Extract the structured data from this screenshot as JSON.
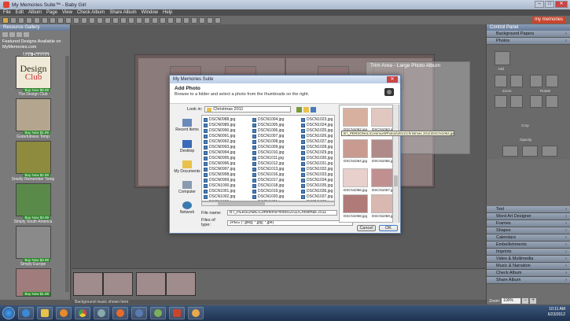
{
  "window": {
    "title": "My Memories Suite™ - Baby Girl"
  },
  "menu": [
    "File",
    "Edit",
    "Album",
    "Page",
    "View",
    "Check Album",
    "Share Album",
    "Window",
    "Help"
  ],
  "brand": "my memories",
  "left_panel": {
    "title": "Resource Gallery",
    "featured": "Featured Designs Available on MyMemories.com",
    "more_button": "More Designs",
    "club_logo_line1": "Design",
    "club_logo_line2": "Club",
    "cards": [
      {
        "name": "The Design Club",
        "badge": "Buy Now $9.99"
      },
      {
        "name": "Gratefulness Temp",
        "badge": "Buy Now $1.99"
      },
      {
        "name": "Smelly Remember Temp",
        "badge": "Buy Now $2.99"
      },
      {
        "name": "Simply South America",
        "badge": "Buy Now $3.99"
      },
      {
        "name": "Simply Europe",
        "badge": "Buy Now $3.99"
      }
    ],
    "badge_last": "Buy Now $1.99"
  },
  "canvas": {
    "trim_title": "Trim Area - Large Photo Album"
  },
  "status": "Background music shown here",
  "control_panel": {
    "title": "Control Panel",
    "top_items": [
      "Background Papers",
      "Photos"
    ],
    "labels": {
      "add": "Add",
      "zoom": "Zoom",
      "rotate": "Rotate",
      "crop": "Crop",
      "opacity": "Opacity"
    },
    "bottom_items": [
      "Text",
      "Word Art Designer",
      "Frames",
      "Shapes",
      "Calendars",
      "Embellishments",
      "Imprints",
      "Video & Multimedia",
      "Music & Narration",
      "Check Album",
      "Share Album"
    ]
  },
  "zoom": {
    "label": "Zoom:",
    "value": "100%",
    "minus": "−",
    "plus": "+"
  },
  "dialog": {
    "title": "My Memories Suite",
    "close": "✕",
    "heading": "Add Photo",
    "subheading": "Browse to a folder and select a photo from the thumbnails on the right.",
    "look_in_label": "Look in:",
    "look_in_value": "Christmas 2011",
    "places": [
      "Recent Items",
      "Desktop",
      "My Documents",
      "Computer",
      "Network"
    ],
    "files_col1": [
      "DSCN0988.jpg",
      "DSCN0989.jpg",
      "DSCN0990.jpg",
      "DSCN0991.jpg",
      "DSCN0992.jpg",
      "DSCN0993.jpg",
      "DSCN0994.jpg",
      "DSCN0995.jpg",
      "DSCN0996.jpg",
      "DSCN0997.jpg",
      "DSCN0998.jpg",
      "DSCN0999.jpg",
      "DSCN1000.jpg",
      "DSCN1001.jpg",
      "DSCN1002.jpg",
      "DSCN1003.jpg"
    ],
    "files_col2": [
      "DSCN1004.jpg",
      "DSCN1005.jpg",
      "DSCN1006.jpg",
      "DSCN1007.jpg",
      "DSCN1008.jpg",
      "DSCN1009.jpg",
      "DSCN1010.jpg",
      "DSCN1011.jpg",
      "DSCN1012.jpg",
      "DSCN1013.jpg",
      "DSCN1016.jpg",
      "DSCN1017.jpg",
      "DSCN1018.jpg",
      "DSCN1019.jpg",
      "DSCN1020.jpg",
      "DSCN1021.jpg",
      "DSCN1022.jpg"
    ],
    "files_col3": [
      "DSCN1023.jpg",
      "DSCN1024.jpg",
      "DSCN1025.jpg",
      "DSCN1026.jpg",
      "DSCN1027.jpg",
      "DSCN1028.jpg",
      "DSCN1029.jpg",
      "DSCN1030.jpg",
      "DSCN1031.jpg",
      "DSCN1032.jpg",
      "DSCN1033.jpg",
      "DSCN1034.jpg",
      "DSCN1035.jpg",
      "DSCN1036.jpg",
      "DSCN1037.jpg",
      "DSCN1038.jpg",
      "DSCN1039.jpg"
    ],
    "file_name_label": "File name:",
    "file_name_value": "B:\\_PERSONAL\\Common\\Photos\\2011\\Christmas 2011",
    "file_type_label": "Files of type:",
    "file_type_value": "JPEG (*.jpeg; *.jpg; *.jpe)",
    "preview_labels": [
      "DSCN1062.jpg",
      "DSCN1063.jpg",
      "DSCN1064.jpg",
      "DSCN1065.jpg",
      "DSCN1066.jpg",
      "DSCN1067.jpg",
      "DSCN1068.jpg",
      "DSCN1069.jpg"
    ],
    "tooltip": "B:\\_PERSONAL\\Common\\Photos\\2011\\Christmas 2011\\DSCN1063.jpg",
    "cancel": "Cancel",
    "ok": "OK"
  },
  "clock": {
    "time": "10:11 AM",
    "date": "6/23/2012"
  }
}
